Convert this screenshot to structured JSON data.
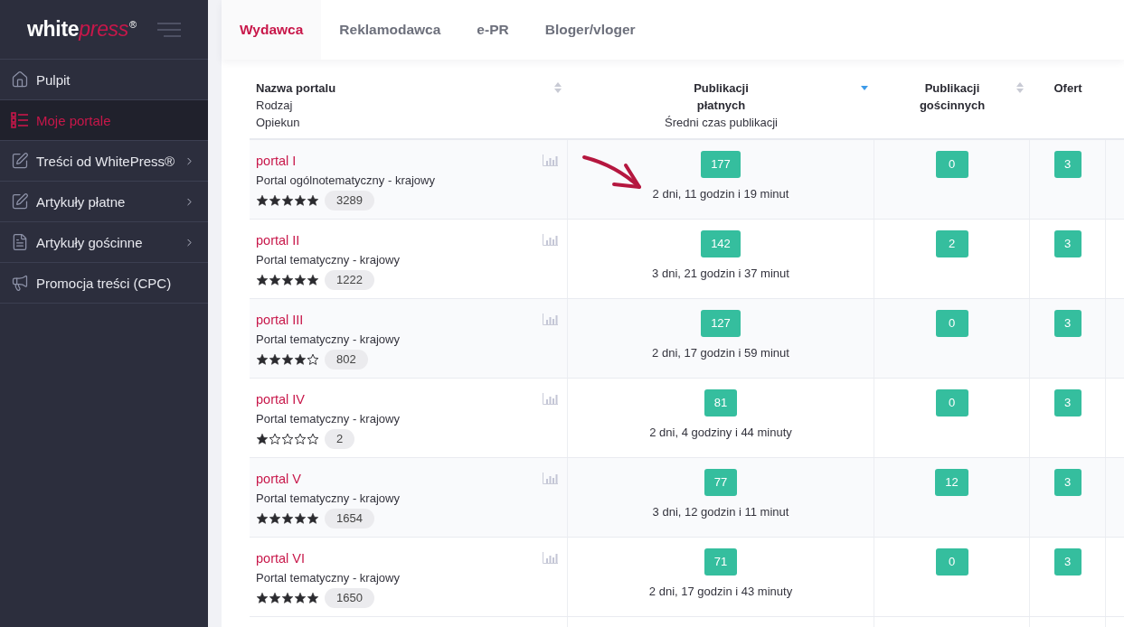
{
  "sidebar": {
    "logo": {
      "first_word": "white",
      "second_word": "press",
      "trademark": "®"
    },
    "items": [
      {
        "label": "Pulpit",
        "selected": false,
        "expandable": false
      },
      {
        "label": "Moje portale",
        "selected": true,
        "expandable": false
      },
      {
        "label": "Treści od WhitePress®",
        "selected": false,
        "expandable": true
      },
      {
        "label": "Artykuły płatne",
        "selected": false,
        "expandable": true
      },
      {
        "label": "Artykuły gościnne",
        "selected": false,
        "expandable": true
      },
      {
        "label": "Promocja treści (CPC)",
        "selected": false,
        "expandable": false
      }
    ]
  },
  "tabs": [
    {
      "label": "Wydawca",
      "selected": true
    },
    {
      "label": "Reklamodawca",
      "selected": false
    },
    {
      "label": "e-PR",
      "selected": false
    },
    {
      "label": "Bloger/vloger",
      "selected": false
    }
  ],
  "table": {
    "columns": [
      {
        "title": "Nazwa portalu",
        "subtitles": [
          "Rodzaj",
          "Opiekun"
        ],
        "sortable": true,
        "sorted": false
      },
      {
        "title": "Publikacji płatnych",
        "subtitles": [
          "Średni czas publikacji"
        ],
        "sortable": true,
        "sorted": true
      },
      {
        "title": "Publikacji gościnnych",
        "sortable": true,
        "sorted": false
      },
      {
        "title": "Ofert",
        "sortable": false,
        "sorted": false
      }
    ],
    "rows": [
      {
        "name": "portal I",
        "type": "Portal ogólnotematyczny - krajowy",
        "stars": 5,
        "rating_count": "3289",
        "paid_publications": "177",
        "average_time": "2 dni, 11 godzin i 19 minut",
        "guest_publications": "0",
        "offers": "3",
        "marked": true
      },
      {
        "name": "portal II",
        "type": "Portal tematyczny - krajowy",
        "stars": 5,
        "rating_count": "1222",
        "paid_publications": "142",
        "average_time": "3 dni, 21 godzin i 37 minut",
        "guest_publications": "2",
        "offers": "3",
        "marked": false
      },
      {
        "name": "portal III",
        "type": "Portal tematyczny - krajowy",
        "stars": 4,
        "rating_count": "802",
        "paid_publications": "127",
        "average_time": "2 dni, 17 godzin i 59 minut",
        "guest_publications": "0",
        "offers": "3",
        "marked": false
      },
      {
        "name": "portal IV",
        "type": "Portal tematyczny - krajowy",
        "stars": 1,
        "rating_count": "2",
        "paid_publications": "81",
        "average_time": "2 dni, 4 godziny i 44 minuty",
        "guest_publications": "0",
        "offers": "3",
        "marked": false
      },
      {
        "name": "portal V",
        "type": "Portal tematyczny - krajowy",
        "stars": 5,
        "rating_count": "1654",
        "paid_publications": "77",
        "average_time": "3 dni, 12 godzin i 11 minut",
        "guest_publications": "12",
        "offers": "3",
        "marked": false
      },
      {
        "name": "portal VI",
        "type": "Portal tematyczny - krajowy",
        "stars": 5,
        "rating_count": "1650",
        "paid_publications": "71",
        "average_time": "2 dni, 17 godzin i 43 minuty",
        "guest_publications": "0",
        "offers": "3",
        "marked": false
      }
    ]
  }
}
